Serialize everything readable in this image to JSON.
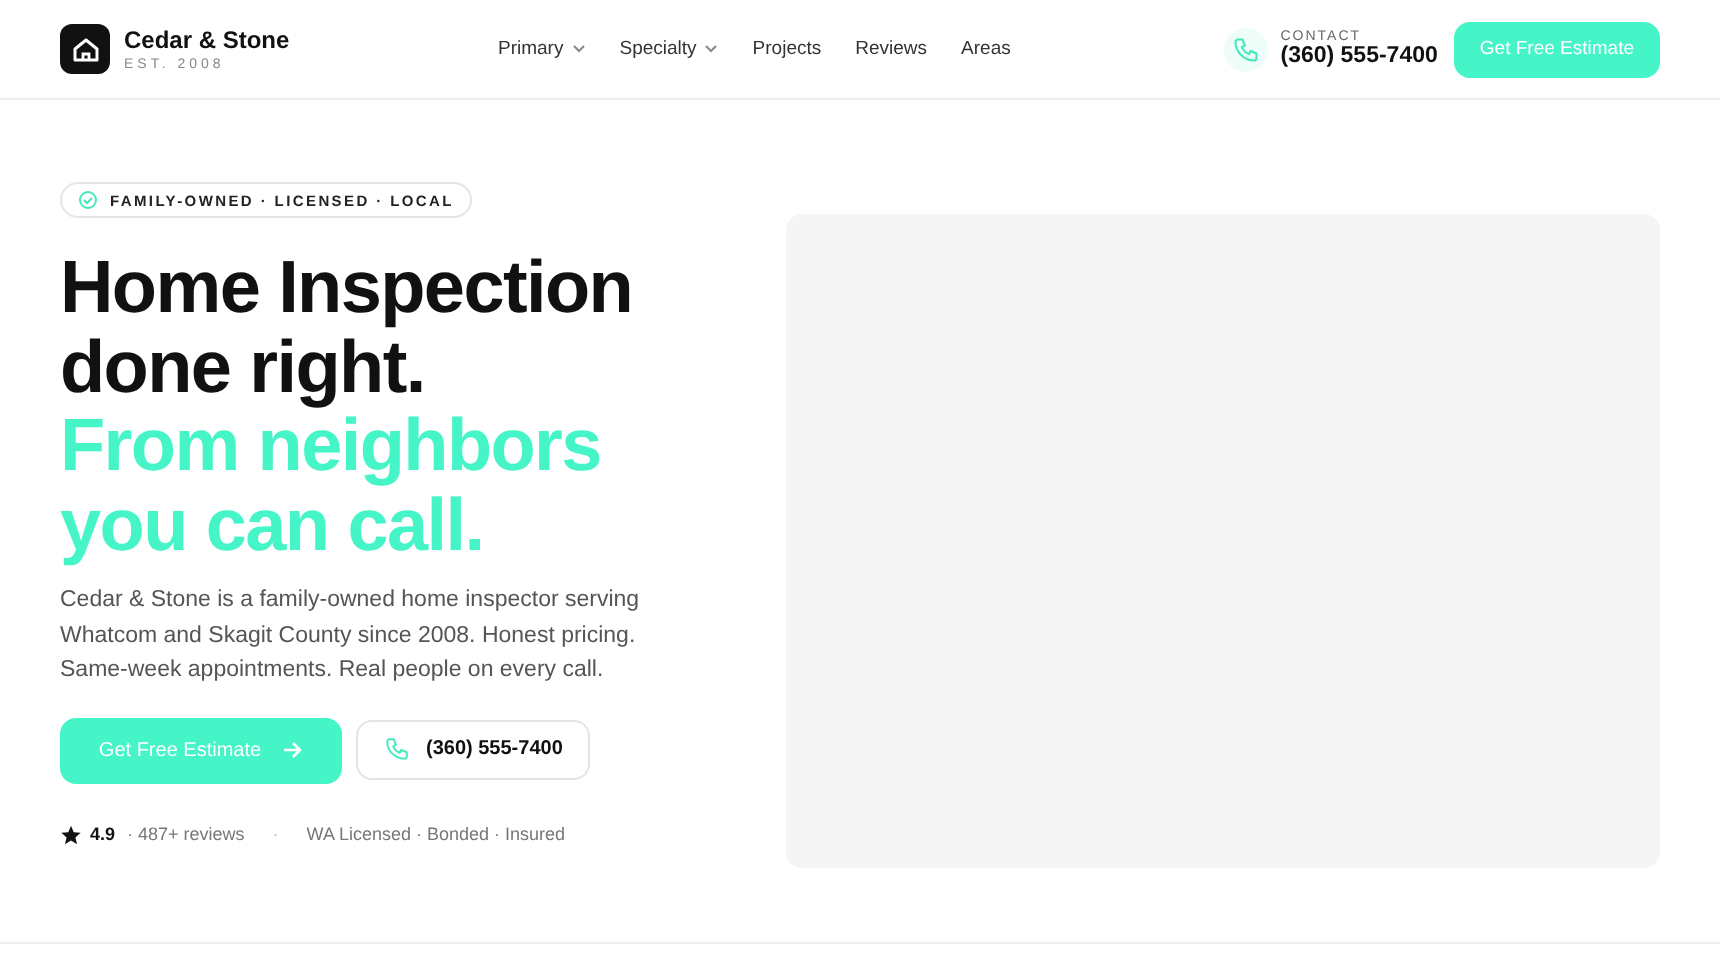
{
  "brand": {
    "name": "Cedar & Stone",
    "tagline": "EST. 2008"
  },
  "nav": [
    {
      "label": "Primary",
      "has_menu": true
    },
    {
      "label": "Specialty",
      "has_menu": true
    },
    {
      "label": "Projects",
      "has_menu": false
    },
    {
      "label": "Reviews",
      "has_menu": false
    },
    {
      "label": "Areas",
      "has_menu": false
    }
  ],
  "contact": {
    "label": "CONTACT",
    "phone": "(360) 555-7400"
  },
  "header_cta": "Get Free Estimate",
  "hero": {
    "badge": "FAMILY-OWNED · LICENSED · LOCAL",
    "title_lines": [
      "Home Inspection",
      "done right."
    ],
    "accent_lines": [
      "From neighbors",
      "you can call."
    ],
    "description": "Cedar & Stone is a family-owned home inspector serving Whatcom and Skagit County since 2008. Honest pricing. Same-week appointments. Real people on every call.",
    "primary_button": "Get Free Estimate",
    "phone_button": "(360) 555-7400",
    "rating": "4.9",
    "reviews": "· 487+ reviews",
    "separator": "·",
    "credentials": "WA Licensed · Bonded · Insured"
  }
}
